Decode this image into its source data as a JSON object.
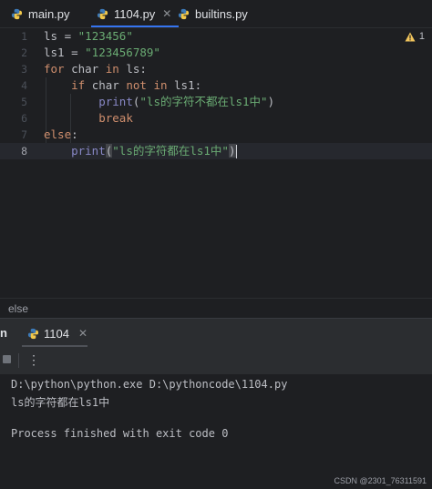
{
  "tabs": [
    {
      "label": "main.py",
      "active": false
    },
    {
      "label": "1104.py",
      "active": true
    },
    {
      "label": "builtins.py",
      "active": false
    }
  ],
  "warnings": {
    "count": "1"
  },
  "editor": {
    "line_numbers": [
      "1",
      "2",
      "3",
      "4",
      "5",
      "6",
      "7",
      "8"
    ],
    "lines": {
      "l1": {
        "var": "ls",
        "op": " = ",
        "str": "\"123456\""
      },
      "l2": {
        "var": "ls1",
        "op": " = ",
        "str": "\"123456789\""
      },
      "l3": {
        "kw1": "for",
        "t1": " char ",
        "kw2": "in",
        "t2": " ls:"
      },
      "l4": {
        "kw1": "if",
        "t1": " char ",
        "kw2": "not",
        "t2": " ",
        "kw3": "in",
        "t3": " ls1:"
      },
      "l5": {
        "fn": "print",
        "open": "(",
        "str": "\"ls的字符不都在ls1中\"",
        "close": ")"
      },
      "l6": {
        "kw": "break"
      },
      "l7": {
        "kw": "else",
        "t": ":"
      },
      "l8": {
        "fn": "print",
        "open": "(",
        "str": "\"ls的字符都在ls1中\"",
        "close": ")"
      }
    }
  },
  "breadcrumb": {
    "text": "else"
  },
  "run_panel": {
    "title": "n",
    "tab_label": "1104"
  },
  "console": {
    "lines": [
      "D:\\python\\python.exe D:\\pythoncode\\1104.py",
      "ls的字符都在ls1中",
      "",
      "Process finished with exit code 0"
    ]
  },
  "watermark": "CSDN @2301_76311591",
  "colors": {
    "background": "#1e1f22",
    "keyword": "#cf8e6d",
    "string": "#6aab73",
    "builtin": "#8888c6",
    "accent": "#3574f0"
  }
}
